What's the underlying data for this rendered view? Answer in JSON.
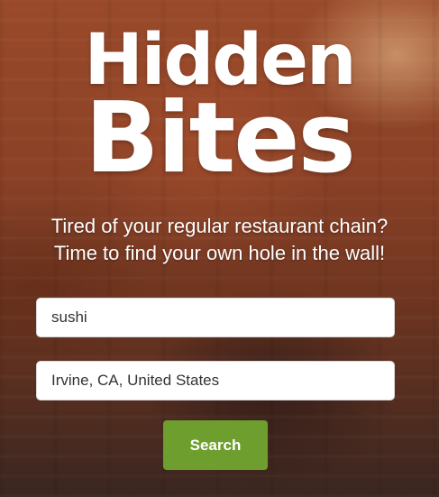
{
  "logo": {
    "line1": "Hidden",
    "line2": "Bites"
  },
  "tagline": {
    "line1": "Tired of your regular restaurant chain?",
    "line2": "Time to find your own hole in the wall!"
  },
  "search": {
    "food_value": "sushi",
    "location_value": "Irvine, CA, United States",
    "button_label": "Search"
  },
  "colors": {
    "button": "#6e9e2e",
    "text": "#ffffff"
  }
}
